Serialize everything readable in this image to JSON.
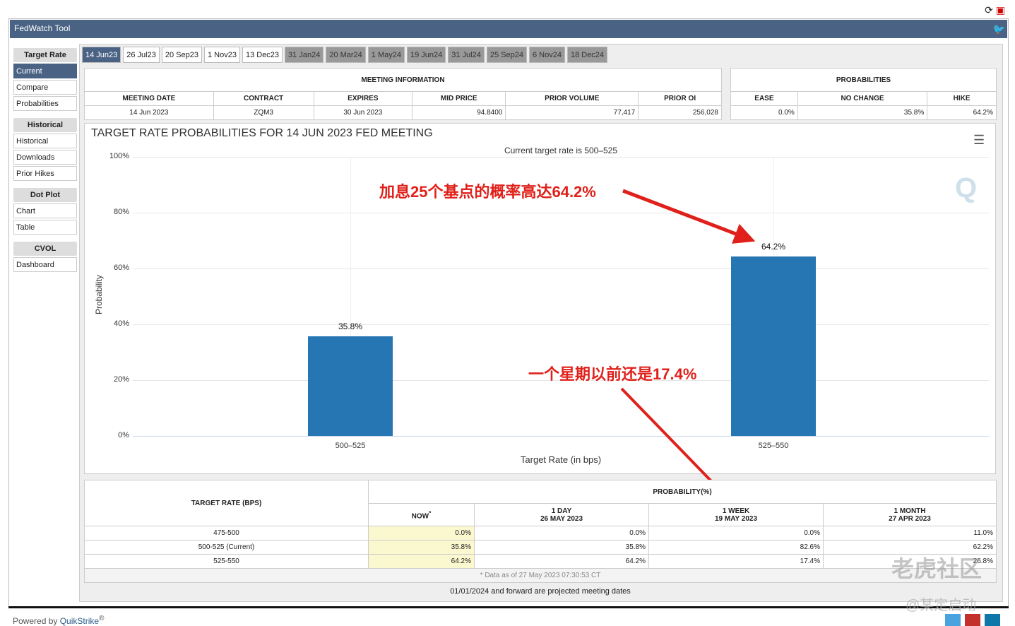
{
  "window": {
    "title": "FedWatch Tool",
    "reload_icon": "reload-icon",
    "pdf_icon": "pdf-icon",
    "twitter_icon": "twitter-icon"
  },
  "sidebar": [
    {
      "heading": "Target Rate",
      "items": [
        "Current",
        "Compare",
        "Probabilities"
      ]
    },
    {
      "heading": "Historical",
      "items": [
        "Historical",
        "Downloads",
        "Prior Hikes"
      ]
    },
    {
      "heading": "Dot Plot",
      "items": [
        "Chart",
        "Table"
      ]
    },
    {
      "heading": "CVOL",
      "items": [
        "Dashboard"
      ]
    }
  ],
  "tabs": [
    "14 Jun23",
    "26 Jul23",
    "20 Sep23",
    "1 Nov23",
    "13 Dec23",
    "31 Jan24",
    "20 Mar24",
    "1 May24",
    "19 Jun24",
    "31 Jul24",
    "25 Sep24",
    "6 Nov24",
    "18 Dec24"
  ],
  "meeting_info": {
    "title": "MEETING INFORMATION",
    "headers": [
      "MEETING DATE",
      "CONTRACT",
      "EXPIRES",
      "MID PRICE",
      "PRIOR VOLUME",
      "PRIOR OI"
    ],
    "values": [
      "14 Jun 2023",
      "ZQM3",
      "30 Jun 2023",
      "94.8400",
      "77,417",
      "256,028"
    ]
  },
  "probabilities": {
    "title": "PROBABILITIES",
    "headers": [
      "EASE",
      "NO CHANGE",
      "HIKE"
    ],
    "values": [
      "0.0%",
      "35.8%",
      "64.2%"
    ]
  },
  "chart_data": {
    "type": "bar",
    "title": "TARGET RATE PROBABILITIES FOR 14 JUN 2023 FED MEETING",
    "subtitle": "Current target rate is 500–525",
    "xlabel": "Target Rate (in bps)",
    "ylabel": "Probability",
    "categories": [
      "500–525",
      "525–550"
    ],
    "values": [
      35.8,
      64.2
    ],
    "data_labels": [
      "35.8%",
      "64.2%"
    ],
    "ylim": [
      0,
      100
    ],
    "yticks": [
      "0%",
      "20%",
      "40%",
      "60%",
      "80%",
      "100%"
    ],
    "color": "#2576b3",
    "grid": true
  },
  "annotations": {
    "a1": "加息25个基点的概率高达64.2%",
    "a2": "一个星期以前还是17.4%"
  },
  "prob_table": {
    "col_target": "TARGET RATE (BPS)",
    "col_prob": "PROBABILITY(%)",
    "now": "NOW",
    "now_mark": "*",
    "d1": "1 DAY",
    "d1_date": "26 MAY 2023",
    "w1": "1 WEEK",
    "w1_date": "19 MAY 2023",
    "m1": "1 MONTH",
    "m1_date": "27 APR 2023",
    "rows": [
      [
        "475-500",
        "0.0%",
        "0.0%",
        "0.0%",
        "11.0%"
      ],
      [
        "500-525 (Current)",
        "35.8%",
        "35.8%",
        "82.6%",
        "62.2%"
      ],
      [
        "525-550",
        "64.2%",
        "64.2%",
        "17.4%",
        "26.8%"
      ]
    ],
    "footnote": "* Data as of 27 May 2023 07:30:53 CT"
  },
  "projected_note": "01/01/2024 and forward are projected meeting dates",
  "footer": {
    "powered": "Powered by ",
    "brand": "QuikStrike",
    "reg": "®"
  },
  "watermark": {
    "text1": "老虎社区",
    "text2": "@某定启动"
  }
}
